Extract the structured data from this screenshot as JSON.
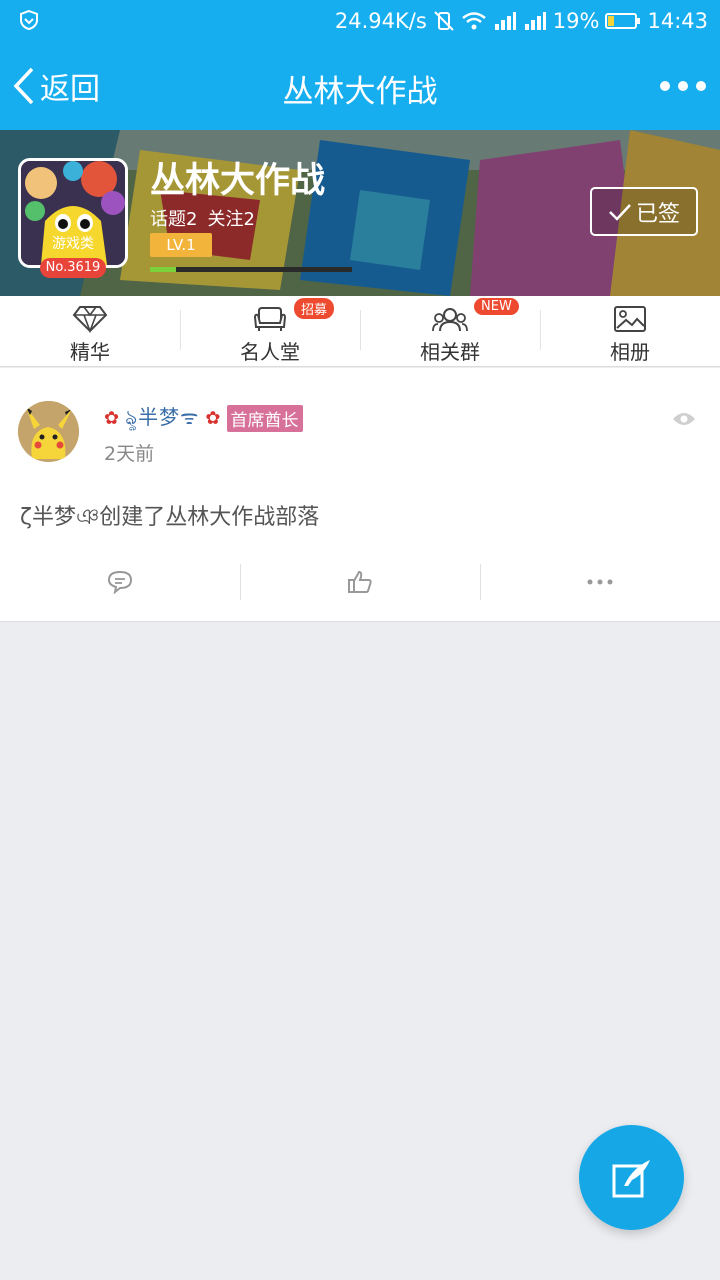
{
  "status_bar": {
    "network_speed": "24.94K/s",
    "battery": "19%",
    "time": "14:43",
    "icons": [
      "shield-icon",
      "vibrate-icon",
      "wifi-icon",
      "signal-icon",
      "signal-icon",
      "battery-icon"
    ]
  },
  "header": {
    "back_label": "返回",
    "title": "丛林大作战",
    "more_icon": "more-icon"
  },
  "tribe": {
    "name": "丛林大作战",
    "topics": "话题2",
    "followers": "关注2",
    "category": "游戏类",
    "rank": "No.3619",
    "level": "LV.1",
    "level_progress": 0.13,
    "sign_label": "已签"
  },
  "tabs": [
    {
      "label": "精华",
      "icon": "diamond-icon",
      "badge": ""
    },
    {
      "label": "名人堂",
      "icon": "sofa-icon",
      "badge": "招募"
    },
    {
      "label": "相关群",
      "icon": "group-icon",
      "badge": "NEW"
    },
    {
      "label": "相册",
      "icon": "picture-icon",
      "badge": ""
    }
  ],
  "post": {
    "author": "ৡ半梦ᯤ",
    "role": "首席酋长",
    "time": "2天前",
    "body": "ζ半梦ঞ创建了丛林大作战部落",
    "actions": [
      "comment-icon",
      "like-icon",
      "more-icon"
    ]
  },
  "fab": {
    "icon": "compose-icon"
  },
  "colors": {
    "primary": "#17aef0",
    "badge": "#ee4a2f",
    "level": "#f2b43a",
    "role": "#d7719a"
  }
}
